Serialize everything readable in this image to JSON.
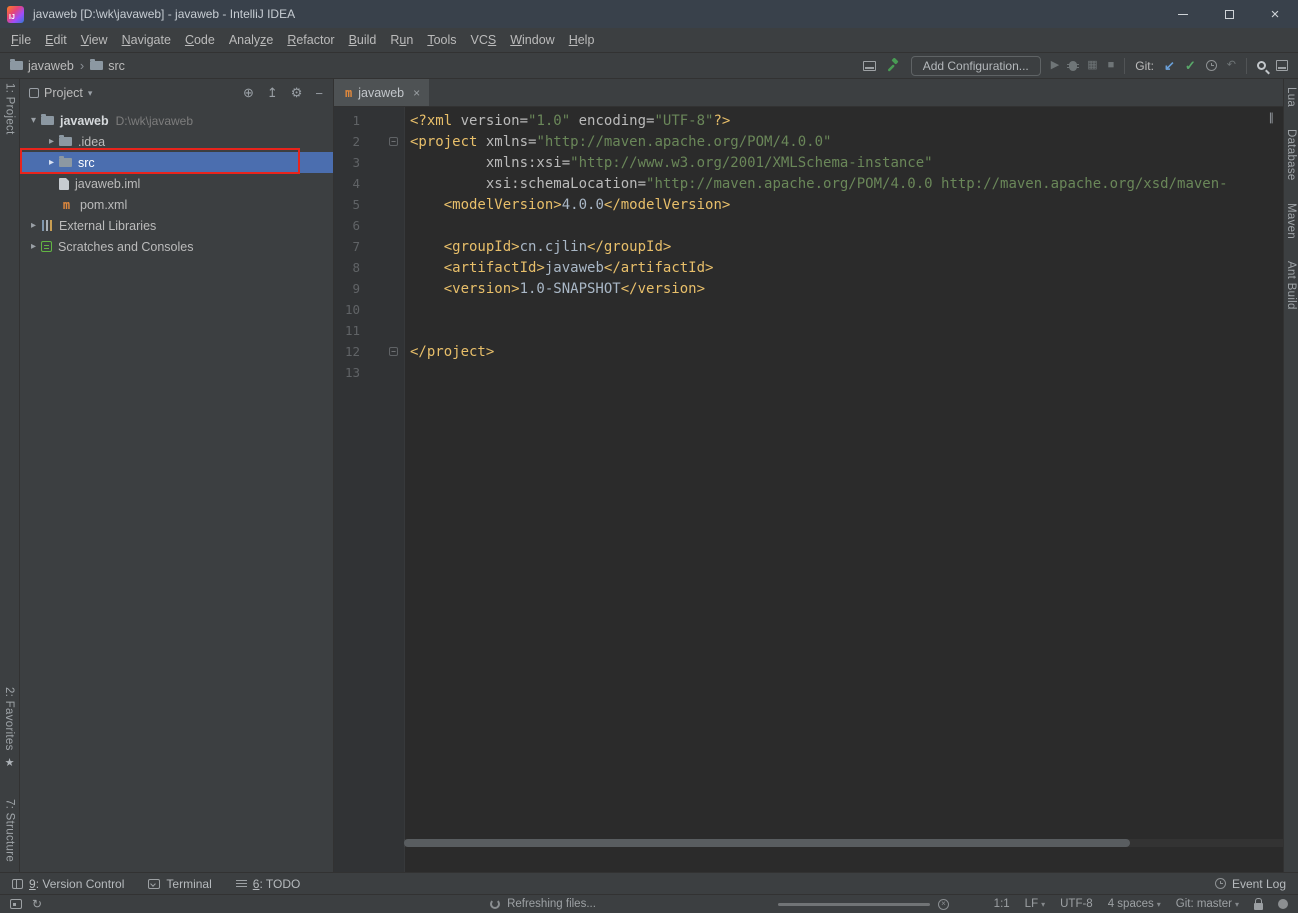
{
  "window": {
    "title": "javaweb [D:\\wk\\javaweb] - javaweb - IntelliJ IDEA",
    "logo_text": "IJ"
  },
  "menu": {
    "items": [
      {
        "label": "File",
        "mnemonic": 0
      },
      {
        "label": "Edit",
        "mnemonic": 0
      },
      {
        "label": "View",
        "mnemonic": 0
      },
      {
        "label": "Navigate",
        "mnemonic": 0
      },
      {
        "label": "Code",
        "mnemonic": 0
      },
      {
        "label": "Analyze",
        "mnemonic": 5
      },
      {
        "label": "Refactor",
        "mnemonic": 0
      },
      {
        "label": "Build",
        "mnemonic": 0
      },
      {
        "label": "Run",
        "mnemonic": 1
      },
      {
        "label": "Tools",
        "mnemonic": 0
      },
      {
        "label": "VCS",
        "mnemonic": 2
      },
      {
        "label": "Window",
        "mnemonic": 0
      },
      {
        "label": "Help",
        "mnemonic": 0
      }
    ]
  },
  "navbar": {
    "breadcrumbs": [
      "javaweb",
      "src"
    ],
    "add_configuration_label": "Add Configuration...",
    "git_label": "Git:"
  },
  "left_stripe": {
    "project": "1: Project",
    "favorites": "2: Favorites",
    "structure": "7: Structure"
  },
  "right_stripe": {
    "items": [
      "Lua",
      "Database",
      "Maven",
      "Ant Build"
    ]
  },
  "project_panel": {
    "title": "Project",
    "tree": [
      {
        "label": "javaweb",
        "hint": "D:\\wk\\javaweb",
        "icon": "folder",
        "arrow": "down",
        "bold": true,
        "indent": 0
      },
      {
        "label": ".idea",
        "icon": "folder",
        "arrow": "right",
        "indent": 1
      },
      {
        "label": "src",
        "icon": "folder",
        "arrow": "right",
        "indent": 1,
        "selected": true,
        "annotated": true
      },
      {
        "label": "javaweb.iml",
        "icon": "file",
        "indent": 1
      },
      {
        "label": "pom.xml",
        "icon": "maven",
        "indent": 1
      },
      {
        "label": "External Libraries",
        "icon": "library",
        "arrow": "right",
        "indent": 0
      },
      {
        "label": "Scratches and Consoles",
        "icon": "scratch",
        "arrow": "right",
        "indent": 0
      }
    ]
  },
  "editor": {
    "tab_label": "javaweb",
    "fold_lines": [
      2,
      12
    ],
    "lines": [
      {
        "n": 1,
        "tokens": [
          {
            "c": "t",
            "v": "<?xml "
          },
          {
            "c": "a",
            "v": "version="
          },
          {
            "c": "s",
            "v": "\"1.0\""
          },
          {
            "c": "a",
            "v": " encoding="
          },
          {
            "c": "s",
            "v": "\"UTF-8\""
          },
          {
            "c": "t",
            "v": "?>"
          }
        ]
      },
      {
        "n": 2,
        "tokens": [
          {
            "c": "t",
            "v": "<project "
          },
          {
            "c": "a",
            "v": "xmlns="
          },
          {
            "c": "s",
            "v": "\"http://maven.apache.org/POM/4.0.0\""
          }
        ]
      },
      {
        "n": 3,
        "tokens": [
          {
            "c": "d",
            "v": "         "
          },
          {
            "c": "a",
            "v": "xmlns:xsi="
          },
          {
            "c": "s",
            "v": "\"http://www.w3.org/2001/XMLSchema-instance\""
          }
        ]
      },
      {
        "n": 4,
        "tokens": [
          {
            "c": "d",
            "v": "         "
          },
          {
            "c": "a",
            "v": "xsi:schemaLocation="
          },
          {
            "c": "s",
            "v": "\"http://maven.apache.org/POM/4.0.0 http://maven.apache.org/xsd/maven-"
          }
        ]
      },
      {
        "n": 5,
        "tokens": [
          {
            "c": "d",
            "v": "    "
          },
          {
            "c": "t",
            "v": "<modelVersion>"
          },
          {
            "c": "x",
            "v": "4.0.0"
          },
          {
            "c": "t",
            "v": "</modelVersion>"
          }
        ]
      },
      {
        "n": 6,
        "tokens": []
      },
      {
        "n": 7,
        "tokens": [
          {
            "c": "d",
            "v": "    "
          },
          {
            "c": "t",
            "v": "<groupId>"
          },
          {
            "c": "x",
            "v": "cn.cjlin"
          },
          {
            "c": "t",
            "v": "</groupId>"
          }
        ]
      },
      {
        "n": 8,
        "tokens": [
          {
            "c": "d",
            "v": "    "
          },
          {
            "c": "t",
            "v": "<artifactId>"
          },
          {
            "c": "x",
            "v": "javaweb"
          },
          {
            "c": "t",
            "v": "</artifactId>"
          }
        ]
      },
      {
        "n": 9,
        "tokens": [
          {
            "c": "d",
            "v": "    "
          },
          {
            "c": "t",
            "v": "<version>"
          },
          {
            "c": "x",
            "v": "1.0-SNAPSHOT"
          },
          {
            "c": "t",
            "v": "</version>"
          }
        ]
      },
      {
        "n": 10,
        "tokens": []
      },
      {
        "n": 11,
        "tokens": []
      },
      {
        "n": 12,
        "tokens": [
          {
            "c": "t",
            "v": "</project>"
          }
        ]
      },
      {
        "n": 13,
        "tokens": []
      }
    ]
  },
  "bottom_bar": {
    "items": [
      {
        "label": "9: Version Control",
        "mnemonic": 0,
        "icon": "vcs"
      },
      {
        "label": "Terminal",
        "mnemonic": null,
        "icon": "terminal"
      },
      {
        "label": "6: TODO",
        "mnemonic": 0,
        "icon": "todo"
      }
    ],
    "event_log": "Event Log"
  },
  "status_bar": {
    "message": "Refreshing files...",
    "caret_position": "1:1",
    "line_separator": "LF",
    "encoding": "UTF-8",
    "indent": "4 spaces",
    "git_branch": "Git: master"
  },
  "colors": {
    "selection_blue": "#4b6eaf",
    "annotation_red": "#e8241c",
    "xml_tag": "#e8bf6a",
    "xml_string": "#6a8759",
    "commit_green": "#59a869",
    "update_blue": "#6a9fd8",
    "maven_orange": "#e0893d",
    "editor_bg": "#2b2b2b",
    "panel_bg": "#3c3f41"
  }
}
